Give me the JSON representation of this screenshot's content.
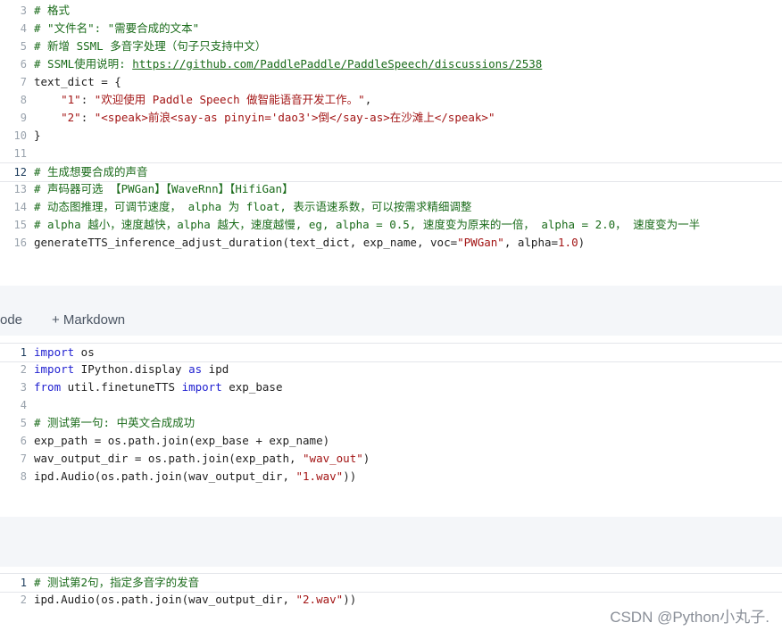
{
  "cell1": {
    "lines": [
      {
        "n": "3",
        "parts": [
          {
            "t": "# 格式",
            "c": "cm"
          }
        ]
      },
      {
        "n": "4",
        "parts": [
          {
            "t": "# \"文件名\": \"需要合成的文本\"",
            "c": "cm"
          }
        ]
      },
      {
        "n": "5",
        "parts": [
          {
            "t": "# 新增 SSML 多音字处理（句子只支持中文）",
            "c": "cm"
          }
        ]
      },
      {
        "n": "6",
        "parts": [
          {
            "t": "# SSML使用说明: ",
            "c": "cm"
          },
          {
            "t": "https://github.com/PaddlePaddle/PaddleSpeech/discussions/2538",
            "c": "url"
          }
        ]
      },
      {
        "n": "7",
        "parts": [
          {
            "t": "text_dict = {",
            "c": ""
          }
        ]
      },
      {
        "n": "8",
        "parts": [
          {
            "t": "    ",
            "c": ""
          },
          {
            "t": "\"1\"",
            "c": "st"
          },
          {
            "t": ": ",
            "c": ""
          },
          {
            "t": "\"欢迎使用 Paddle Speech 做智能语音开发工作。\"",
            "c": "st"
          },
          {
            "t": ",",
            "c": ""
          }
        ]
      },
      {
        "n": "9",
        "parts": [
          {
            "t": "    ",
            "c": ""
          },
          {
            "t": "\"2\"",
            "c": "st"
          },
          {
            "t": ": ",
            "c": ""
          },
          {
            "t": "\"<speak>前浪<say-as pinyin='dao3'>倒</say-as>在沙滩上</speak>\"",
            "c": "st"
          }
        ]
      },
      {
        "n": "10",
        "parts": [
          {
            "t": "}",
            "c": ""
          }
        ]
      },
      {
        "n": "11",
        "parts": []
      },
      {
        "n": "12",
        "active": true,
        "parts": [
          {
            "t": "# 生成想要合成的声音",
            "c": "cm"
          }
        ]
      },
      {
        "n": "13",
        "parts": [
          {
            "t": "# 声码器可选 【PWGan】【WaveRnn】【HifiGan】",
            "c": "cm"
          }
        ]
      },
      {
        "n": "14",
        "parts": [
          {
            "t": "# 动态图推理，可调节速度， alpha 为 float, 表示语速系数，可以按需求精细调整",
            "c": "cm"
          }
        ]
      },
      {
        "n": "15",
        "parts": [
          {
            "t": "# alpha 越小，速度越快，alpha 越大，速度越慢, eg, alpha = 0.5, 速度变为原来的一倍， alpha = 2.0， 速度变为一半",
            "c": "cm"
          }
        ]
      },
      {
        "n": "16",
        "parts": [
          {
            "t": "generateTTS_inference_adjust_duration(text_dict, exp_name, voc=",
            "c": ""
          },
          {
            "t": "\"PWGan\"",
            "c": "st"
          },
          {
            "t": ", alpha=",
            "c": ""
          },
          {
            "t": "1.0",
            "c": "st"
          },
          {
            "t": ")",
            "c": ""
          }
        ]
      }
    ]
  },
  "toolbar": {
    "code_label": "ode",
    "markdown_label": "+ Markdown"
  },
  "cell2": {
    "lines": [
      {
        "n": "1",
        "active": true,
        "parts": [
          {
            "t": "import",
            "c": "kw"
          },
          {
            "t": " os",
            "c": ""
          }
        ]
      },
      {
        "n": "2",
        "parts": [
          {
            "t": "import",
            "c": "kw"
          },
          {
            "t": " IPython.display ",
            "c": ""
          },
          {
            "t": "as",
            "c": "kw"
          },
          {
            "t": " ipd",
            "c": ""
          }
        ]
      },
      {
        "n": "3",
        "parts": [
          {
            "t": "from",
            "c": "kw"
          },
          {
            "t": " util.finetuneTTS ",
            "c": ""
          },
          {
            "t": "import",
            "c": "kw"
          },
          {
            "t": " exp_base",
            "c": ""
          }
        ]
      },
      {
        "n": "4",
        "parts": []
      },
      {
        "n": "5",
        "parts": [
          {
            "t": "# 测试第一句: 中英文合成成功",
            "c": "cm"
          }
        ]
      },
      {
        "n": "6",
        "parts": [
          {
            "t": "exp_path = os.path.join(exp_base + exp_name)",
            "c": ""
          }
        ]
      },
      {
        "n": "7",
        "parts": [
          {
            "t": "wav_output_dir = os.path.join(exp_path, ",
            "c": ""
          },
          {
            "t": "\"wav_out\"",
            "c": "st"
          },
          {
            "t": ")",
            "c": ""
          }
        ]
      },
      {
        "n": "8",
        "parts": [
          {
            "t": "ipd.Audio(os.path.join(wav_output_dir, ",
            "c": ""
          },
          {
            "t": "\"1.wav\"",
            "c": "st"
          },
          {
            "t": "))",
            "c": ""
          }
        ]
      }
    ]
  },
  "cell3": {
    "lines": [
      {
        "n": "1",
        "active": true,
        "parts": [
          {
            "t": "# 测试第2句，指定多音字的发音",
            "c": "cm"
          }
        ]
      },
      {
        "n": "2",
        "parts": [
          {
            "t": "ipd.Audio(os.path.join(wav_output_dir, ",
            "c": ""
          },
          {
            "t": "\"2.wav\"",
            "c": "st"
          },
          {
            "t": "))",
            "c": ""
          }
        ]
      }
    ]
  },
  "watermark": "CSDN @Python小丸子."
}
